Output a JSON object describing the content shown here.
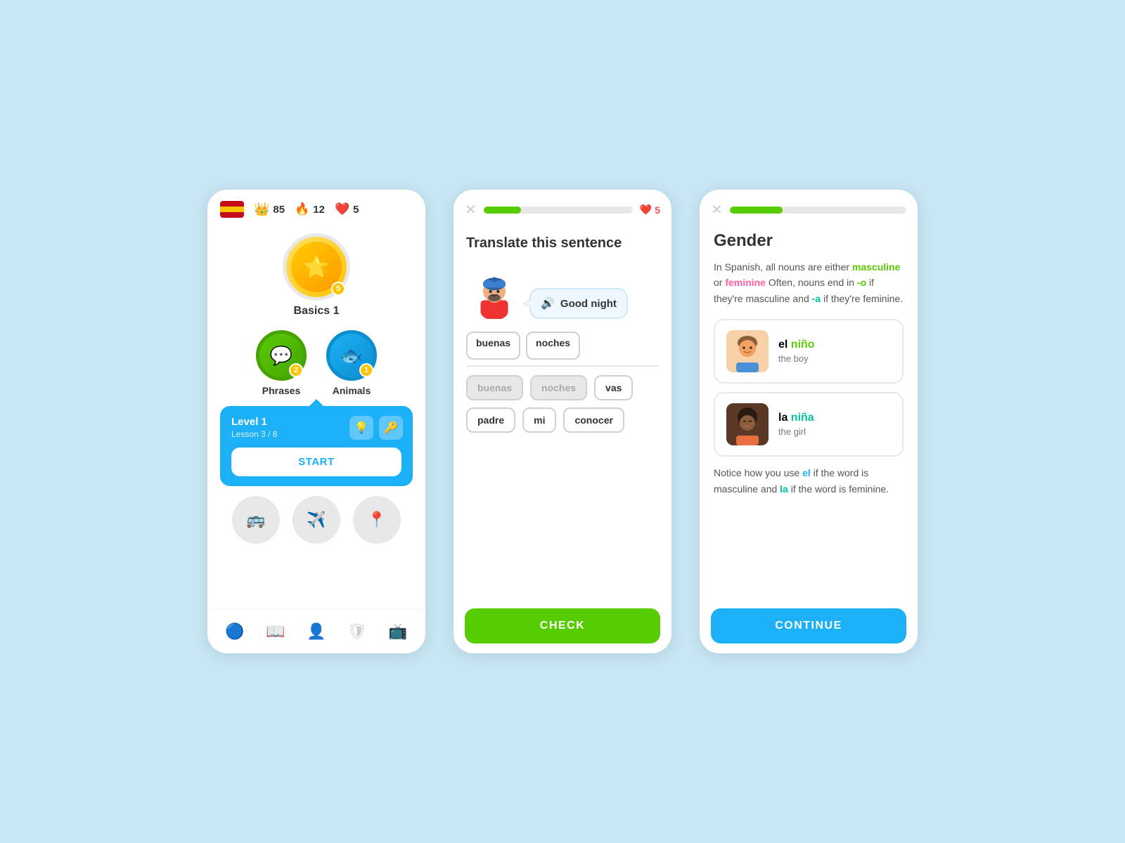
{
  "background": "#c8e6f5",
  "screen1": {
    "header": {
      "crown_count": "85",
      "fire_count": "12",
      "hearts_count": "5"
    },
    "basics": {
      "label": "Basics 1",
      "badge": "5"
    },
    "phrases": {
      "label": "Phrases",
      "badge": "2"
    },
    "animals": {
      "label": "Animals",
      "badge": "1"
    },
    "level": {
      "title": "Level 1",
      "lesson": "Lesson 3 / 8",
      "start_label": "START"
    },
    "nav": {
      "items": [
        "🏠",
        "📖",
        "🎭",
        "🛡",
        "📺"
      ]
    }
  },
  "screen2": {
    "header": {
      "hearts": "5",
      "progress": "25"
    },
    "title": "Translate this sentence",
    "speech": {
      "text": "Good night"
    },
    "answer_words": [
      "buenas",
      "noches"
    ],
    "word_bank": [
      {
        "text": "buenas",
        "used": true
      },
      {
        "text": "noches",
        "used": true
      },
      {
        "text": "vas",
        "used": false
      },
      {
        "text": "padre",
        "used": false
      },
      {
        "text": "mi",
        "used": false
      },
      {
        "text": "conocer",
        "used": false
      }
    ],
    "check_label": "CHECK"
  },
  "screen3": {
    "header": {
      "progress": "30"
    },
    "title": "Gender",
    "description1": "In Spanish, all nouns are either",
    "masculine": "masculine",
    "or": " or ",
    "feminine": "feminine",
    "description2": " Often, nouns end in ",
    "o_ending": "-o",
    "description3": " if they're masculine and ",
    "a_ending": "-a",
    "description4": " if they're feminine.",
    "boy_card": {
      "el": "el ",
      "nino": "niño",
      "translation": "the boy"
    },
    "girl_card": {
      "la": "la ",
      "nina": "niña",
      "translation": "the girl"
    },
    "note1": "Notice how you use ",
    "note_el": "el",
    "note2": " if the word is masculine and ",
    "note_la": "la",
    "note3": " if the word is feminine.",
    "continue_label": "CONTINUE"
  }
}
